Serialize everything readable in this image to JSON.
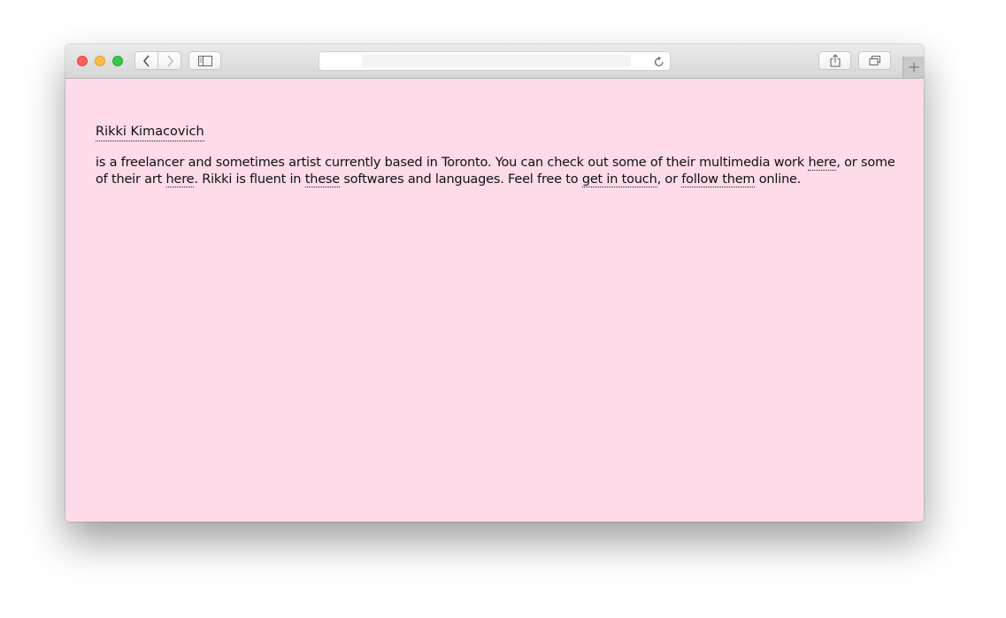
{
  "browser": {
    "address_text": "",
    "icons": {
      "back": "chevron-left-icon",
      "forward": "chevron-right-icon",
      "sidebar": "sidebar-icon",
      "reload": "reload-icon",
      "share": "share-icon",
      "tabs": "tabs-overview-icon",
      "new_tab": "plus-icon"
    }
  },
  "page": {
    "background_color": "#fddbe8",
    "name": "Rikki Kimacovich",
    "bio": {
      "t1": "is a freelancer and sometimes artist currently based in Toronto. You can check out some of their multimedia work ",
      "link1": "here",
      "t2": ", or some of their art ",
      "link2": "here",
      "t3": ". Rikki is fluent in ",
      "link3": "these",
      "t4": " softwares and languages. Feel free to ",
      "link4": "get in touch",
      "t5": ", or ",
      "link5": "follow them",
      "t6": " online."
    }
  }
}
